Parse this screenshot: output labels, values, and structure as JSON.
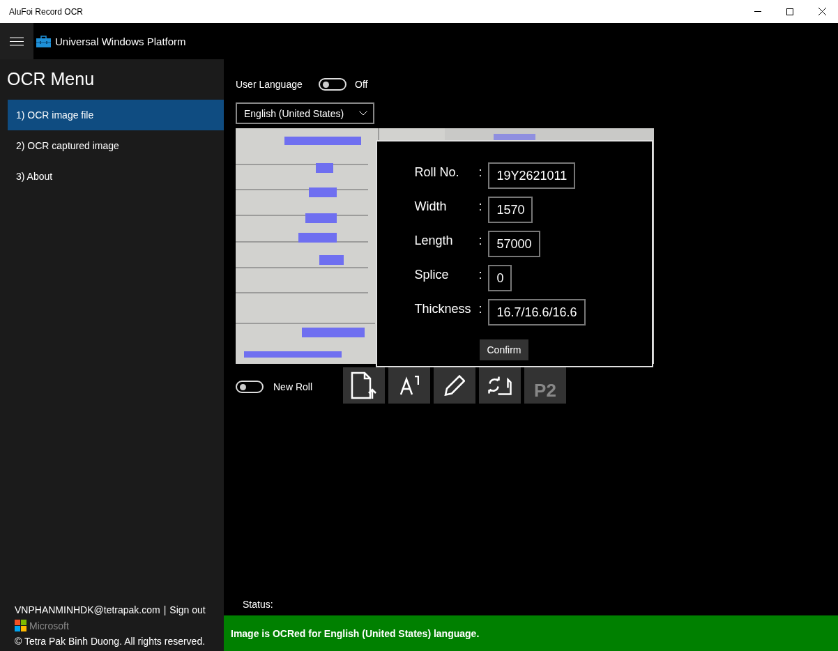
{
  "window": {
    "title": "AluFoi Record OCR"
  },
  "header": {
    "title": "Universal Windows Platform"
  },
  "menu": {
    "title": "OCR Menu",
    "items": [
      {
        "label": "1) OCR image file",
        "selected": true
      },
      {
        "label": "2) OCR captured image",
        "selected": false
      },
      {
        "label": "3) About",
        "selected": false
      }
    ]
  },
  "footer": {
    "account": "VNPHANMINHDK@tetrapak.com",
    "separator": "|",
    "sign_out": "Sign out",
    "brand": "Microsoft",
    "copyright": "© Tetra Pak Binh Duong. All rights reserved."
  },
  "user_language": {
    "label": "User Language",
    "on": false,
    "state_text": "Off"
  },
  "language_select": {
    "value": "English (United States)"
  },
  "new_roll": {
    "label": "New Roll",
    "on": false
  },
  "tools": [
    {
      "kind": "upload",
      "disabled": false
    },
    {
      "kind": "text",
      "disabled": false
    },
    {
      "kind": "edit",
      "disabled": false
    },
    {
      "kind": "rotate",
      "disabled": false
    },
    {
      "kind": "label",
      "text": "P2",
      "disabled": true
    }
  ],
  "dialog": {
    "fields": [
      {
        "label": "Roll No.",
        "colon": ":",
        "value": "19Y2621011"
      },
      {
        "label": "Width",
        "colon": ":",
        "value": "1570"
      },
      {
        "label": "Length",
        "colon": ":",
        "value": "57000"
      },
      {
        "label": "Splice",
        "colon": ":",
        "value": "0"
      },
      {
        "label": "Thickness",
        "colon": ":",
        "value": "16.7/16.6/16.6"
      }
    ],
    "confirm": "Confirm"
  },
  "status": {
    "label": "Status:",
    "message": "Image is OCRed for English (United States) language."
  }
}
